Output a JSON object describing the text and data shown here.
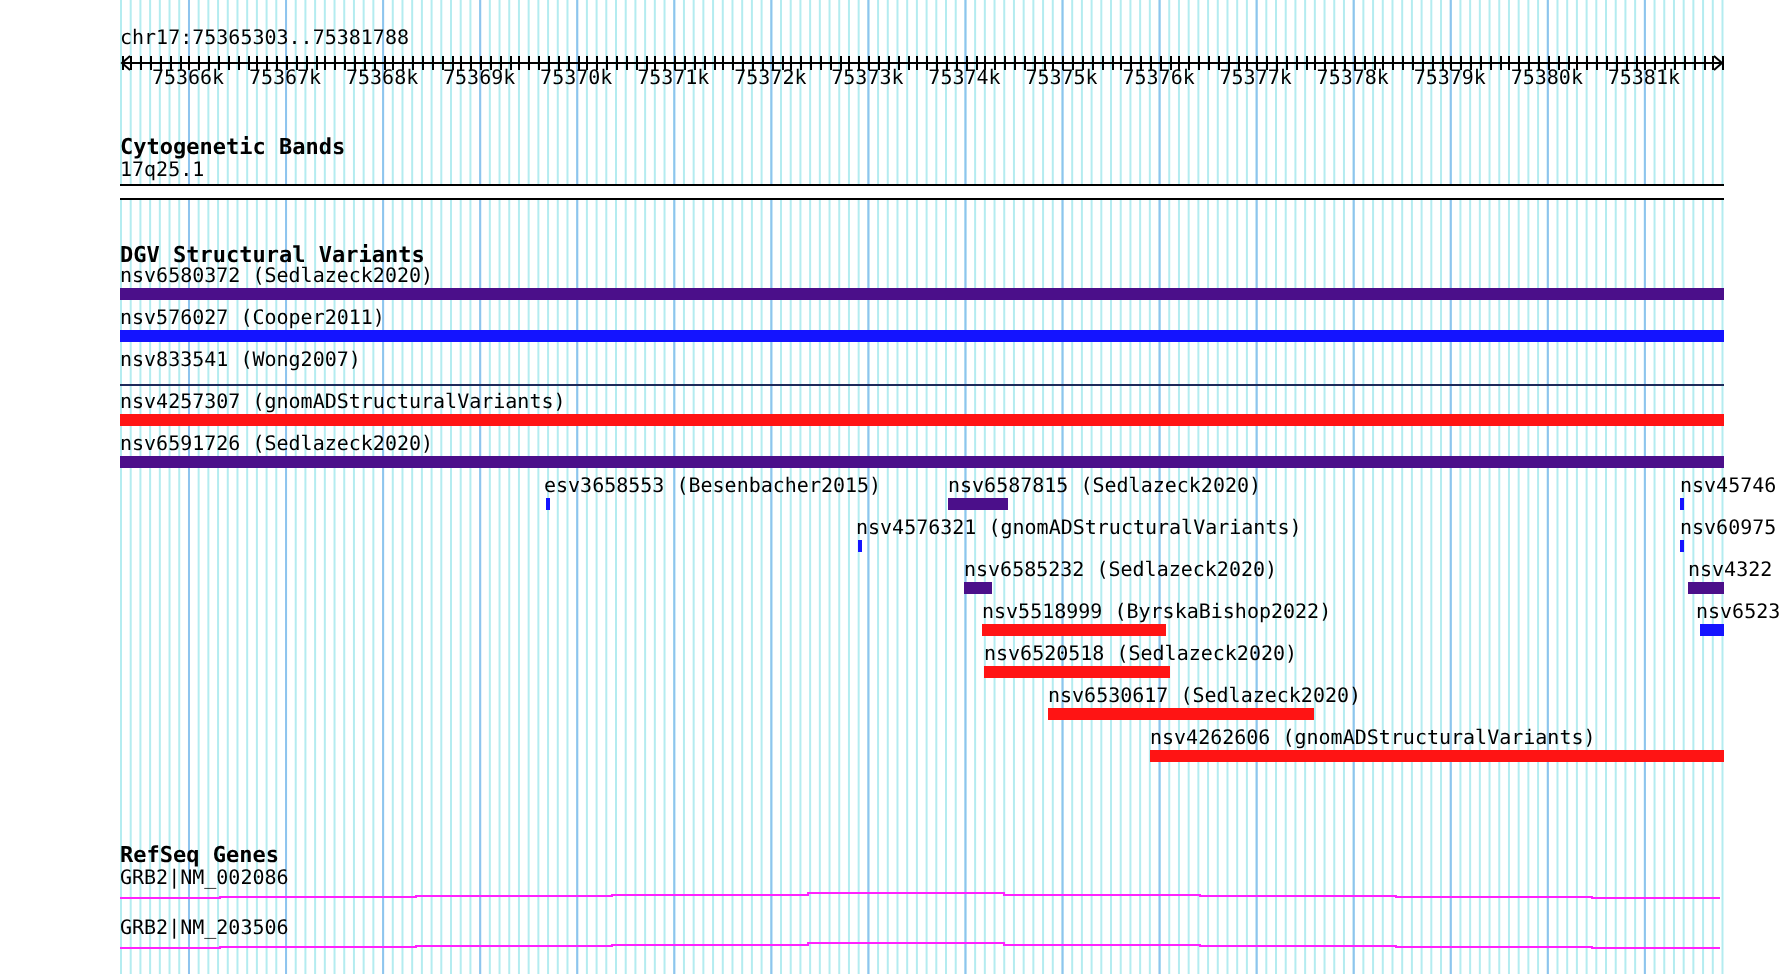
{
  "location": "chr17:75365303..75381788",
  "ruler": {
    "ticks": [
      "75366k",
      "75367k",
      "75368k",
      "75369k",
      "75370k",
      "75371k",
      "75372k",
      "75373k",
      "75374k",
      "75375k",
      "75376k",
      "75377k",
      "75378k",
      "75379k",
      "75380k",
      "75381k"
    ]
  },
  "tracks": [
    {
      "kind": "bands",
      "title": "Cytogenetic Bands",
      "features": [
        {
          "label": "17q25.1"
        }
      ]
    },
    {
      "kind": "variants",
      "title": "DGV Structural Variants",
      "features": [
        {
          "label": "nsv6580372 (Sedlazeck2020)",
          "color": "#4b0f8a"
        },
        {
          "label": "nsv576027 (Cooper2011)",
          "color": "#1414ff"
        },
        {
          "label": "nsv833541 (Wong2007)",
          "color": "#1e2a5a"
        },
        {
          "label": "nsv4257307 (gnomADStructuralVariants)",
          "color": "#ff1414"
        },
        {
          "label": "nsv6591726 (Sedlazeck2020)",
          "color": "#4b0f8a"
        },
        {
          "label": "esv3658553 (Besenbacher2015)",
          "color": "#1414ff"
        },
        {
          "label": "nsv6587815 (Sedlazeck2020)",
          "color": "#4b0f8a"
        },
        {
          "label": "nsv4576321 (gnomADStructuralVariants)",
          "color": "#1414ff"
        },
        {
          "label": "nsv6585232 (Sedlazeck2020)",
          "color": "#4b0f8a"
        },
        {
          "label": "nsv5518999 (ByrskaBishop2022)",
          "color": "#ff1414"
        },
        {
          "label": "nsv6520518 (Sedlazeck2020)",
          "color": "#ff1414"
        },
        {
          "label": "nsv6530617 (Sedlazeck2020)",
          "color": "#ff1414"
        },
        {
          "label": "nsv4262606 (gnomADStructuralVariants)",
          "color": "#ff1414"
        },
        {
          "label": "nsv45746",
          "color": "#1414ff"
        },
        {
          "label": "nsv60975",
          "color": "#1414ff"
        },
        {
          "label": "nsv4322",
          "color": "#4b0f8a"
        },
        {
          "label": "nsv6523",
          "color": "#1414ff"
        }
      ]
    },
    {
      "kind": "genes",
      "title": "RefSeq Genes",
      "features": [
        {
          "label": "GRB2|NM_002086"
        },
        {
          "label": "GRB2|NM_203506"
        }
      ]
    }
  ]
}
